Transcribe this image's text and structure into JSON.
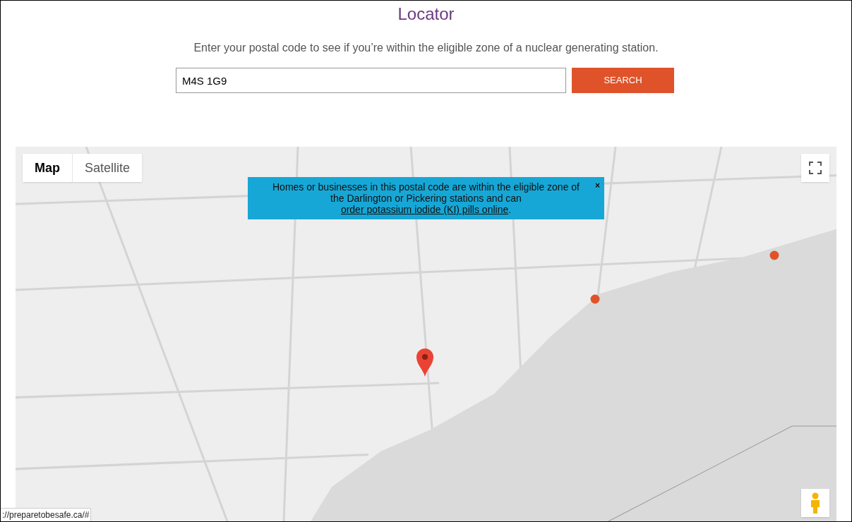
{
  "title": "Locator",
  "intro": "Enter your postal code to see if you’re within the eligible zone of a nuclear generating station.",
  "search": {
    "value": "M4S 1G9",
    "button": "SEARCH"
  },
  "map": {
    "types": [
      {
        "label": "Map",
        "selected": true
      },
      {
        "label": "Satellite",
        "selected": false
      }
    ],
    "notice": {
      "text": "Homes or businesses in this postal code are within the eligible zone of the Darlington or Pickering stations and can ",
      "link": "order potassium iodide (KI) pills online",
      "after": ".",
      "close": "×"
    }
  },
  "status_bar": "://preparetobesafe.ca/#"
}
